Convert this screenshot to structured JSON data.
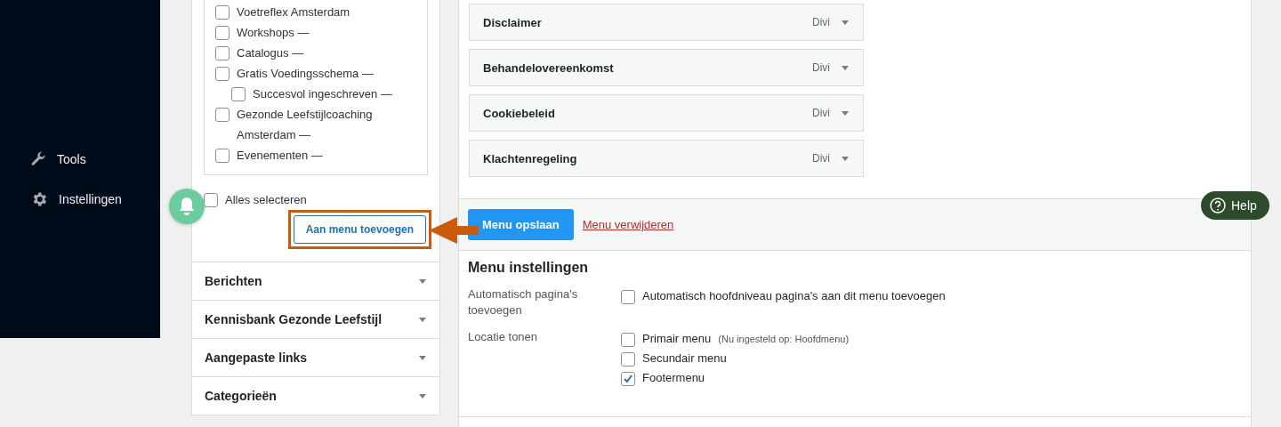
{
  "sidebar": {
    "items": [
      {
        "label": "Tools"
      },
      {
        "label": "Instellingen"
      }
    ]
  },
  "left_panel": {
    "checklist": [
      {
        "label": "Voetreflex Amsterdam",
        "checked": false
      },
      {
        "label": "Workshops —",
        "checked": false
      },
      {
        "label": "Catalogus —",
        "checked": false
      },
      {
        "label": "Gratis Voedingsschema —",
        "checked": false,
        "children": [
          {
            "label": "Succesvol ingeschreven —",
            "checked": false
          }
        ]
      },
      {
        "label": "Gezonde Leefstijlcoaching Amsterdam —",
        "checked": false
      },
      {
        "label": "Evenementen —",
        "checked": false
      }
    ],
    "select_all": {
      "label": "Alles selecteren",
      "checked": false
    },
    "add_button": "Aan menu toevoegen",
    "sections": [
      {
        "title": "Berichten",
        "expanded": false
      },
      {
        "title": "Kennisbank Gezonde Leefstijl",
        "expanded": false
      },
      {
        "title": "Aangepaste links",
        "expanded": false
      },
      {
        "title": "Categorieën",
        "expanded": false
      }
    ]
  },
  "menu_structure": {
    "items": [
      {
        "title": "Disclaimer",
        "type": "Divi"
      },
      {
        "title": "Behandelovereenkomst",
        "type": "Divi"
      },
      {
        "title": "Cookiebeleid",
        "type": "Divi"
      },
      {
        "title": "Klachtenregeling",
        "type": "Divi"
      }
    ],
    "save_button": "Menu opslaan",
    "delete_link": "Menu verwijderen",
    "settings": {
      "title": "Menu instellingen",
      "rows": [
        {
          "label": "Automatisch pagina's toevoegen",
          "options": [
            {
              "label": "Automatisch hoofdniveau pagina's aan dit menu toevoegen",
              "checked": false
            }
          ]
        },
        {
          "label": "Locatie tonen",
          "options": [
            {
              "label": "Primair menu",
              "note": "(Nu ingesteld op: Hoofdmenu)",
              "checked": false
            },
            {
              "label": "Secundair menu",
              "checked": false
            },
            {
              "label": "Footermenu",
              "checked": true
            }
          ]
        }
      ]
    }
  },
  "help_button": "Help"
}
